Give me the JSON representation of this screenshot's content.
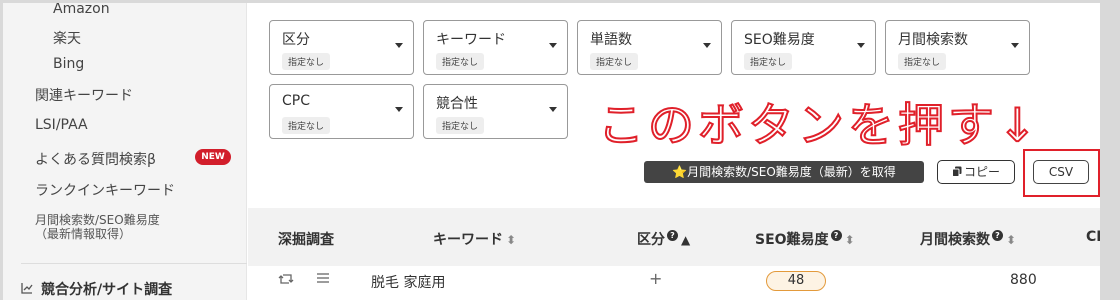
{
  "sidebar": {
    "items": [
      {
        "label": "Amazon"
      },
      {
        "label": "楽天"
      },
      {
        "label": "Bing"
      },
      {
        "label": "関連キーワード"
      },
      {
        "label": "LSI/PAA"
      },
      {
        "label": "よくある質問検索β"
      },
      {
        "label": "ランクインキーワード"
      }
    ],
    "new_badge": "NEW",
    "volume_item_line1": "月間検索数/SEO難易度",
    "volume_item_line2": "（最新情報取得）",
    "section_icon": "chart-line-icon",
    "section_label": "競合分析/サイト調査"
  },
  "filters": [
    {
      "label": "区分",
      "value": "指定なし"
    },
    {
      "label": "キーワード",
      "value": "指定なし"
    },
    {
      "label": "単語数",
      "value": "指定なし"
    },
    {
      "label": "SEO難易度",
      "value": "指定なし"
    },
    {
      "label": "月間検索数",
      "value": "指定なし"
    },
    {
      "label": "CPC",
      "value": "指定なし"
    },
    {
      "label": "競合性",
      "value": "指定なし"
    }
  ],
  "annotation": "このボタンを押す↓",
  "toolbar": {
    "fetch_label": "⭐月間検索数/SEO難易度（最新）を取得",
    "copy_label": "コピー",
    "copy_icon": "copy-icon",
    "csv_label": "CSV"
  },
  "table": {
    "headers": {
      "deep": "深掘調査",
      "keyword": "キーワード",
      "category": "区分",
      "seo": "SEO難易度",
      "volume": "月間検索数",
      "cpc": "CP"
    },
    "row": {
      "refresh_icon": "refresh-icon",
      "menu_icon": "menu-icon",
      "keyword": "脱毛 家庭用",
      "category": "+",
      "seo": "48",
      "volume": "880"
    }
  },
  "colors": {
    "annotation_red": "#e0202a",
    "new_badge": "#d21e2b",
    "seo_pill_border": "#e39a3b"
  }
}
